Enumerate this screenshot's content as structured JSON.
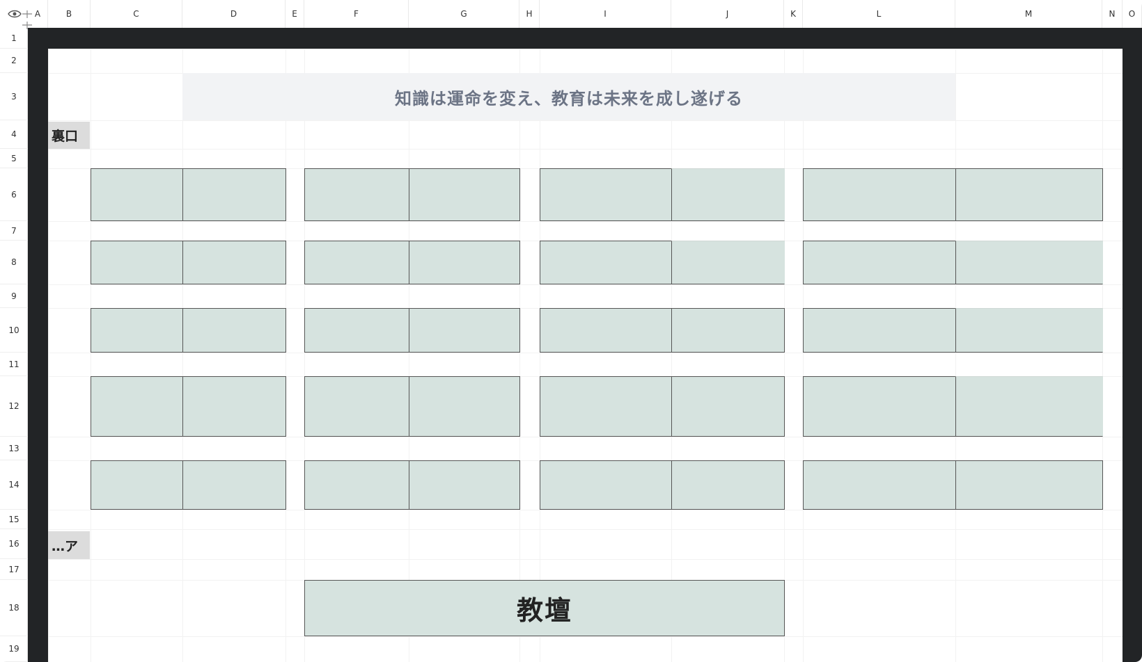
{
  "column_headers": [
    "A",
    "B",
    "C",
    "D",
    "E",
    "F",
    "G",
    "H",
    "I",
    "J",
    "K",
    "L",
    "M",
    "N",
    "O"
  ],
  "row_headers": [
    "1",
    "2",
    "3",
    "4",
    "5",
    "6",
    "7",
    "8",
    "9",
    "10",
    "11",
    "12",
    "13",
    "14",
    "15",
    "16",
    "17",
    "18",
    "19"
  ],
  "banner_text": "知識は運命を変え、教育は未来を成し遂げる",
  "back_door_label": "裏口",
  "front_door_label": "…ア",
  "podium_label": "教壇",
  "colors": {
    "desk_fill": "#d6e3df",
    "frame_dark": "#222426",
    "banner_fill": "#f2f3f5",
    "banner_text": "#6c7485",
    "door_label_fill": "#dcdcdc"
  },
  "corner_icon": "eye-icon"
}
